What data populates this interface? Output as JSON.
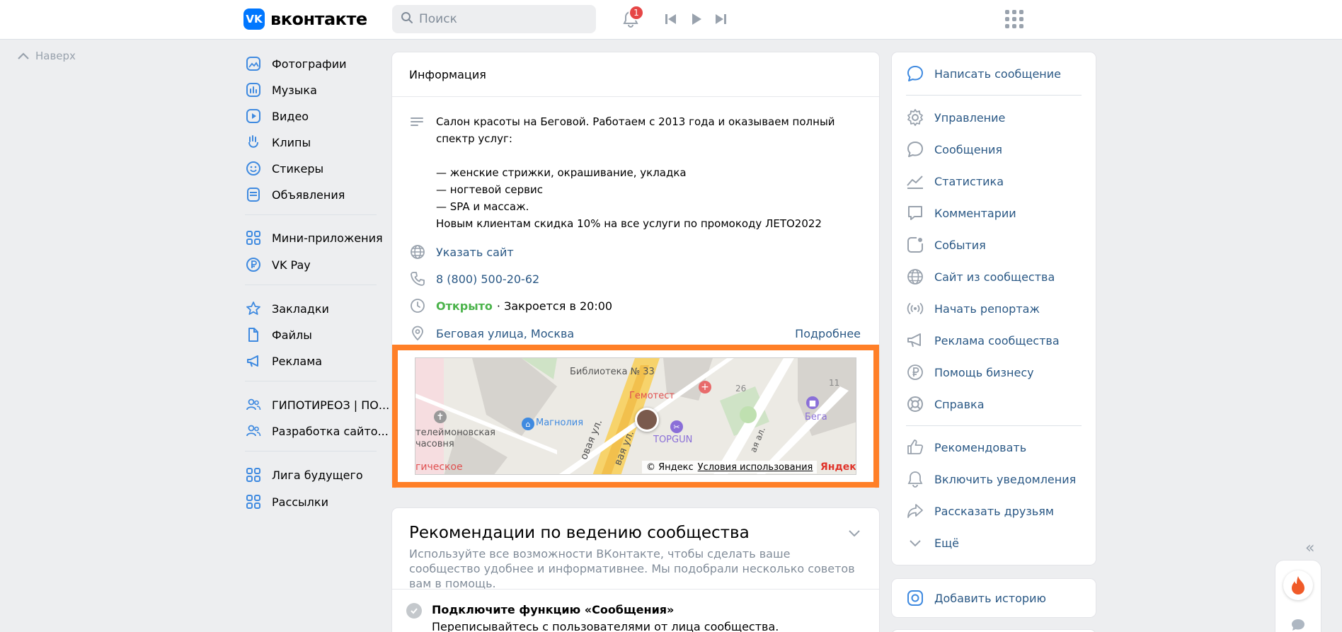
{
  "header": {
    "logo_badge": "VK",
    "logo_text": "вконтакте",
    "search_placeholder": "Поиск",
    "notifications_count": "1"
  },
  "back_to_top": "Наверх",
  "left_nav": {
    "items": [
      {
        "label": "Фотографии",
        "icon": "photos-icon"
      },
      {
        "label": "Музыка",
        "icon": "music-icon"
      },
      {
        "label": "Видео",
        "icon": "video-icon"
      },
      {
        "label": "Клипы",
        "icon": "clips-icon"
      },
      {
        "label": "Стикеры",
        "icon": "stickers-icon"
      },
      {
        "label": "Объявления",
        "icon": "classifieds-icon"
      },
      {
        "label": "Мини-приложения",
        "icon": "mini-apps-icon"
      },
      {
        "label": "VK Pay",
        "icon": "vk-pay-icon"
      },
      {
        "label": "Закладки",
        "icon": "bookmarks-icon"
      },
      {
        "label": "Файлы",
        "icon": "files-icon"
      },
      {
        "label": "Реклама",
        "icon": "ads-icon"
      },
      {
        "label": "ГИПОТИРЕОЗ | ПО...",
        "icon": "group-icon"
      },
      {
        "label": "Разработка сайто...",
        "icon": "group-icon"
      },
      {
        "label": "Лига будущего",
        "icon": "mini-apps-icon"
      },
      {
        "label": "Рассылки",
        "icon": "mini-apps-icon"
      }
    ]
  },
  "info": {
    "title": "Информация",
    "description": "Салон красоты на Беговой. Работаем с 2013 года и оказываем полный\nспектр услуг:\n\n— женские стрижки, окрашивание, укладка\n— ногтевой сервис\n— SPA и массаж.\nНовым клиентам скидка 10% на все услуги по промокоду ЛЕТО2022",
    "website": "Указать сайт",
    "phone": "8 (800) 500-20-62",
    "open_status": "Открыто",
    "closes": "· Закроется в 20:00",
    "address": "Беговая улица, Москва",
    "more": "Подробнее"
  },
  "map": {
    "labels": {
      "library": "Библиотека № 33",
      "gemotest": "Гемотест",
      "chapel": "телеймоновская\nчасовня",
      "magnolia": "Магнолия",
      "topgun": "TOPGUN",
      "bega": "Бега",
      "street1": "овая ул.",
      "street2": "вая ул.",
      "street3": "ая ал.",
      "house26": "26",
      "house11": "11",
      "partial": "гическое"
    },
    "copyright": "© Яндекс",
    "terms": "Условия использования",
    "brand": "Яндекс",
    "highlight_color": "#ff7f27"
  },
  "recommendations": {
    "title": "Рекомендации по ведению сообщества",
    "description": "Используйте все возможности ВКонтакте, чтобы сделать ваше сообщество удобнее и информативнее. Мы подобрали несколько советов вам в помощь.",
    "item_title": "Подключите функцию «Сообщения»",
    "item_desc": "Переписывайтесь с пользователями от лица сообщества."
  },
  "right_menu": {
    "primary": "Написать сообщение",
    "items": [
      {
        "label": "Управление",
        "icon": "gear-icon"
      },
      {
        "label": "Сообщения",
        "icon": "chat-icon"
      },
      {
        "label": "Статистика",
        "icon": "stats-icon"
      },
      {
        "label": "Комментарии",
        "icon": "comment-icon"
      },
      {
        "label": "События",
        "icon": "events-icon"
      },
      {
        "label": "Сайт из сообщества",
        "icon": "globe-icon"
      },
      {
        "label": "Начать репортаж",
        "icon": "broadcast-icon"
      },
      {
        "label": "Реклама сообщества",
        "icon": "megaphone-icon"
      },
      {
        "label": "Помощь бизнесу",
        "icon": "ruble-icon"
      },
      {
        "label": "Справка",
        "icon": "lifebuoy-icon"
      }
    ],
    "items2": [
      {
        "label": "Рекомендовать",
        "icon": "like-icon"
      },
      {
        "label": "Включить уведомления",
        "icon": "bell-icon"
      },
      {
        "label": "Рассказать друзьям",
        "icon": "share-icon"
      },
      {
        "label": "Ещё",
        "icon": "chevron-down-icon"
      }
    ],
    "add_story": "Добавить историю"
  },
  "colors": {
    "accent": "#0077ff",
    "link": "#2a5885",
    "open": "#4bb34b",
    "badge": "#e64646"
  }
}
